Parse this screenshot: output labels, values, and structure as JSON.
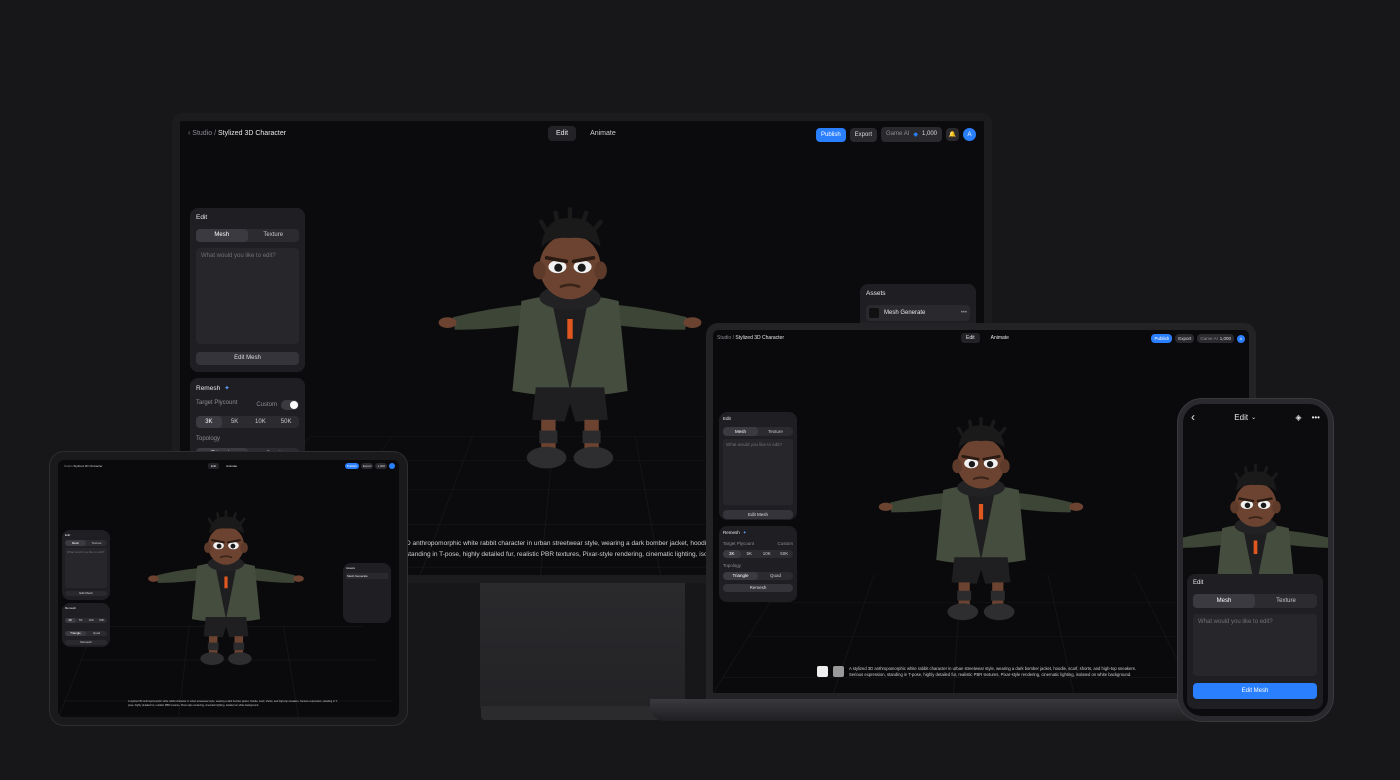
{
  "app": {
    "breadcrumb_root": "Studio",
    "breadcrumb_sep": "/",
    "title": "Stylized 3D Character",
    "tabs": [
      "Edit",
      "Animate"
    ],
    "publish_label": "Publish",
    "export_label": "Export",
    "game_ai_label": "Game AI",
    "credits": "1,000",
    "avatar_initial": "A"
  },
  "edit_panel": {
    "title": "Edit",
    "tabs": [
      "Mesh",
      "Texture"
    ],
    "placeholder": "What would you like to edit?",
    "button": "Edit Mesh"
  },
  "remesh_panel": {
    "title": "Remesh",
    "target_label": "Target Plycount",
    "custom_label": "Custom",
    "counts": [
      "3K",
      "5K",
      "10K",
      "50K"
    ],
    "topology_label": "Topology",
    "topology_options": [
      "Triangle",
      "Quad"
    ],
    "button": "Remesh"
  },
  "assets_panel": {
    "title": "Assets",
    "items": [
      "Mesh Generate"
    ]
  },
  "prompt": {
    "monitor_line1": "D anthropomorphic white rabbit character in urban streetwear style, wearing a dark bomber jacket, hoodie, scarf, sh",
    "monitor_line2": "standing in T-pose, highly detailed fur, realistic PBR textures, Pixar-style rendering, cinematic lighting, isolated on w",
    "laptop_text": "A stylized 3D anthropomorphic white rabbit character in urban streetwear style, wearing a dark bomber jacket, hoodie, scarf, shorts, and high-top sneakers. Serious expression, standing in T-pose, highly detailed fur, realistic PBR textures, Pixar-style rendering, cinematic lighting, isolated on white background."
  },
  "phone": {
    "mode_label": "Edit"
  },
  "colors": {
    "accent": "#2a7fff",
    "background": "#17171a",
    "panel": "#1f1f23"
  }
}
